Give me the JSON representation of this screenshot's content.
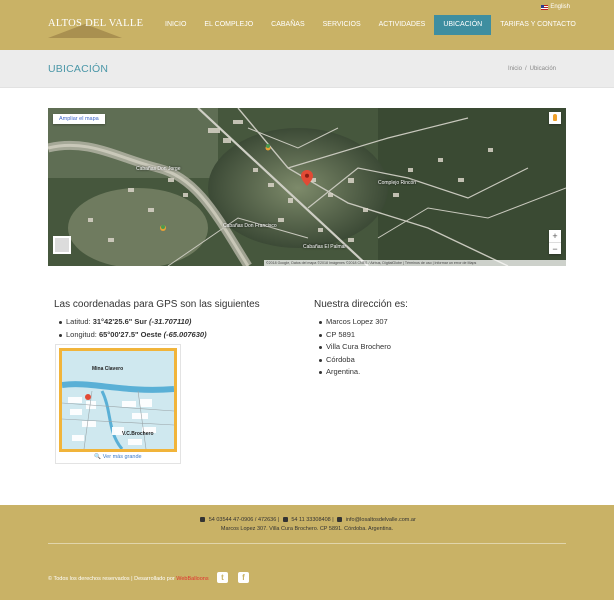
{
  "header": {
    "logo_text": "ALTOS DEL VALLE",
    "language": "English",
    "nav": [
      {
        "label": "INICIO"
      },
      {
        "label": "EL COMPLEJO"
      },
      {
        "label": "CABAÑAS"
      },
      {
        "label": "SERVICIOS"
      },
      {
        "label": "ACTIVIDADES"
      },
      {
        "label": "UBICACIÓN",
        "active": true
      },
      {
        "label": "TARIFAS Y CONTACTO"
      }
    ]
  },
  "title_band": {
    "title": "UBICACIÓN",
    "breadcrumb": [
      "Inicio",
      "/",
      "Ubicación"
    ]
  },
  "map": {
    "expand_label": "Ampliar el mapa",
    "labels": [
      "Cabañas Don Jorge",
      "Cabañas Don Francisco",
      "Cabañas El Palmar",
      "Complejo Rincón"
    ],
    "zoom_in": "+",
    "zoom_out": "−",
    "attribution": "©2018 Google, Datos del mapa ©2018 Imágenes ©2018 CNES / Airbus, DigitalGlobe | Términos de uso | Informar un error de Maps",
    "pin_color": "#e24a35"
  },
  "coords": {
    "heading": "Las coordenadas para GPS son las siguientes",
    "lat_label": "Latitud:",
    "lat_dms": "31°42'25.6\" Sur",
    "lat_dec": "(-31.707110)",
    "lon_label": "Longitud:",
    "lon_dms": "65°00'27.5\" Oeste",
    "lon_dec": "(-65.007630)"
  },
  "thumbnail": {
    "label_top": "Mina Clavero",
    "label_bottom": "V.C.Brochero",
    "caption": "Ver más grande"
  },
  "address": {
    "heading": "Nuestra dirección es:",
    "lines": [
      "Marcos Lopez 307",
      "CP 5891",
      "Villa Cura Brochero",
      "Córdoba",
      "Argentina."
    ]
  },
  "footer": {
    "phone": "54 03544 47-0906 / 472636",
    "mobile": "54 11 33308408",
    "email": "info@losaltosdelvalle.com.ar",
    "address": "Marcos Lopez 307. Villa Cura Brochero. CP 5891. Córdoba. Argentina.",
    "copyright": "© Todos los derechos reservados | Desarrollado por",
    "developer": "WebBalloons",
    "social": [
      "twitter-icon",
      "facebook-icon"
    ]
  },
  "colors": {
    "gold": "#c9b266",
    "teal": "#4b97a8",
    "nav_active": "#3e8ea0"
  }
}
